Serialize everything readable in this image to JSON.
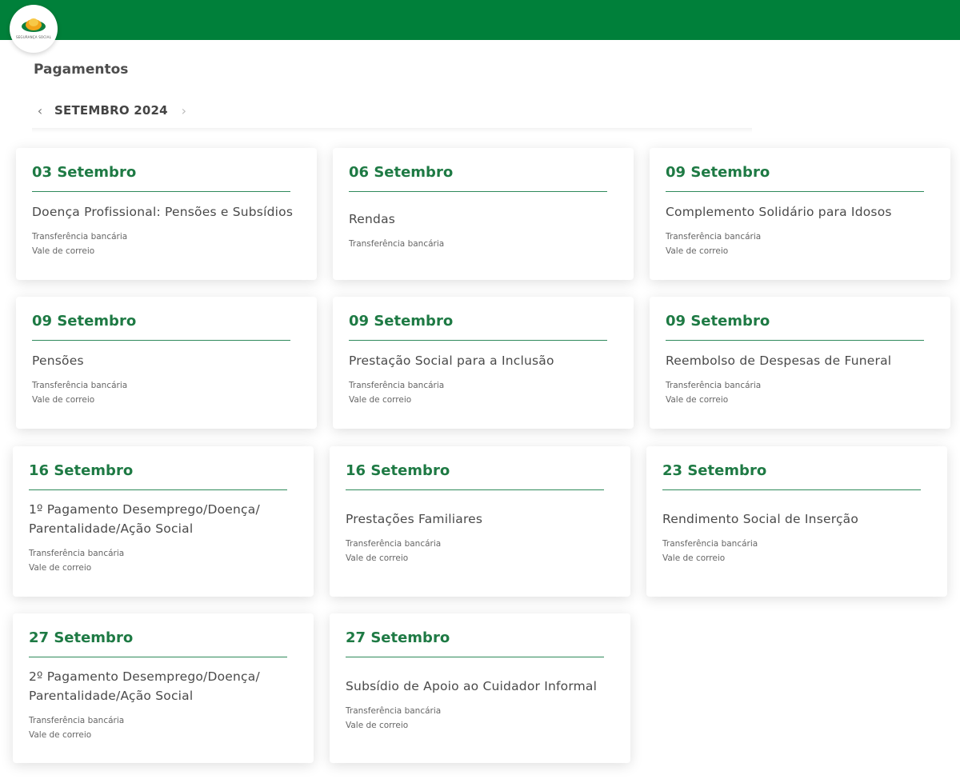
{
  "header": {
    "logo_text": "SEGURANÇA SOCIAL"
  },
  "page": {
    "title": "Pagamentos",
    "month": "SETEMBRO 2024",
    "prev_icon": "chevron-left-icon",
    "next_icon": "chevron-right-icon"
  },
  "colors": {
    "brand_green": "#00803a",
    "date_green": "#1e7a44"
  },
  "payments": [
    {
      "date": "03 Setembro",
      "title": "Doença Profissional: Pensões e Subsídios",
      "methods": [
        "Transferência bancária",
        "Vale de correio"
      ]
    },
    {
      "date": "06 Setembro",
      "title": "Rendas",
      "methods": [
        "Transferência bancária"
      ]
    },
    {
      "date": "09 Setembro",
      "title": "Complemento Solidário para Idosos",
      "methods": [
        "Transferência bancária",
        "Vale de correio"
      ]
    },
    {
      "date": "09 Setembro",
      "title": "Pensões",
      "methods": [
        "Transferência bancária",
        "Vale de correio"
      ]
    },
    {
      "date": "09 Setembro",
      "title": "Prestação Social para a Inclusão",
      "methods": [
        "Transferência bancária",
        "Vale de correio"
      ]
    },
    {
      "date": "09 Setembro",
      "title": "Reembolso de Despesas de Funeral",
      "methods": [
        "Transferência bancária",
        "Vale de correio"
      ]
    },
    {
      "date": "16 Setembro",
      "title": "1º Pagamento Desemprego/Doença/ Parentalidade/Ação Social",
      "methods": [
        "Transferência bancária",
        "Vale de correio"
      ]
    },
    {
      "date": "16 Setembro",
      "title": "Prestações Familiares",
      "methods": [
        "Transferência bancária",
        "Vale de correio"
      ]
    },
    {
      "date": "23 Setembro",
      "title": "Rendimento Social de Inserção",
      "methods": [
        "Transferência bancária",
        "Vale de correio"
      ]
    },
    {
      "date": "27 Setembro",
      "title": "2º Pagamento Desemprego/Doença/ Parentalidade/Ação Social",
      "methods": [
        "Transferência bancária",
        "Vale de correio"
      ]
    },
    {
      "date": "27 Setembro",
      "title": "Subsídio de Apoio ao Cuidador Informal",
      "methods": [
        "Transferência bancária",
        "Vale de correio"
      ]
    }
  ]
}
